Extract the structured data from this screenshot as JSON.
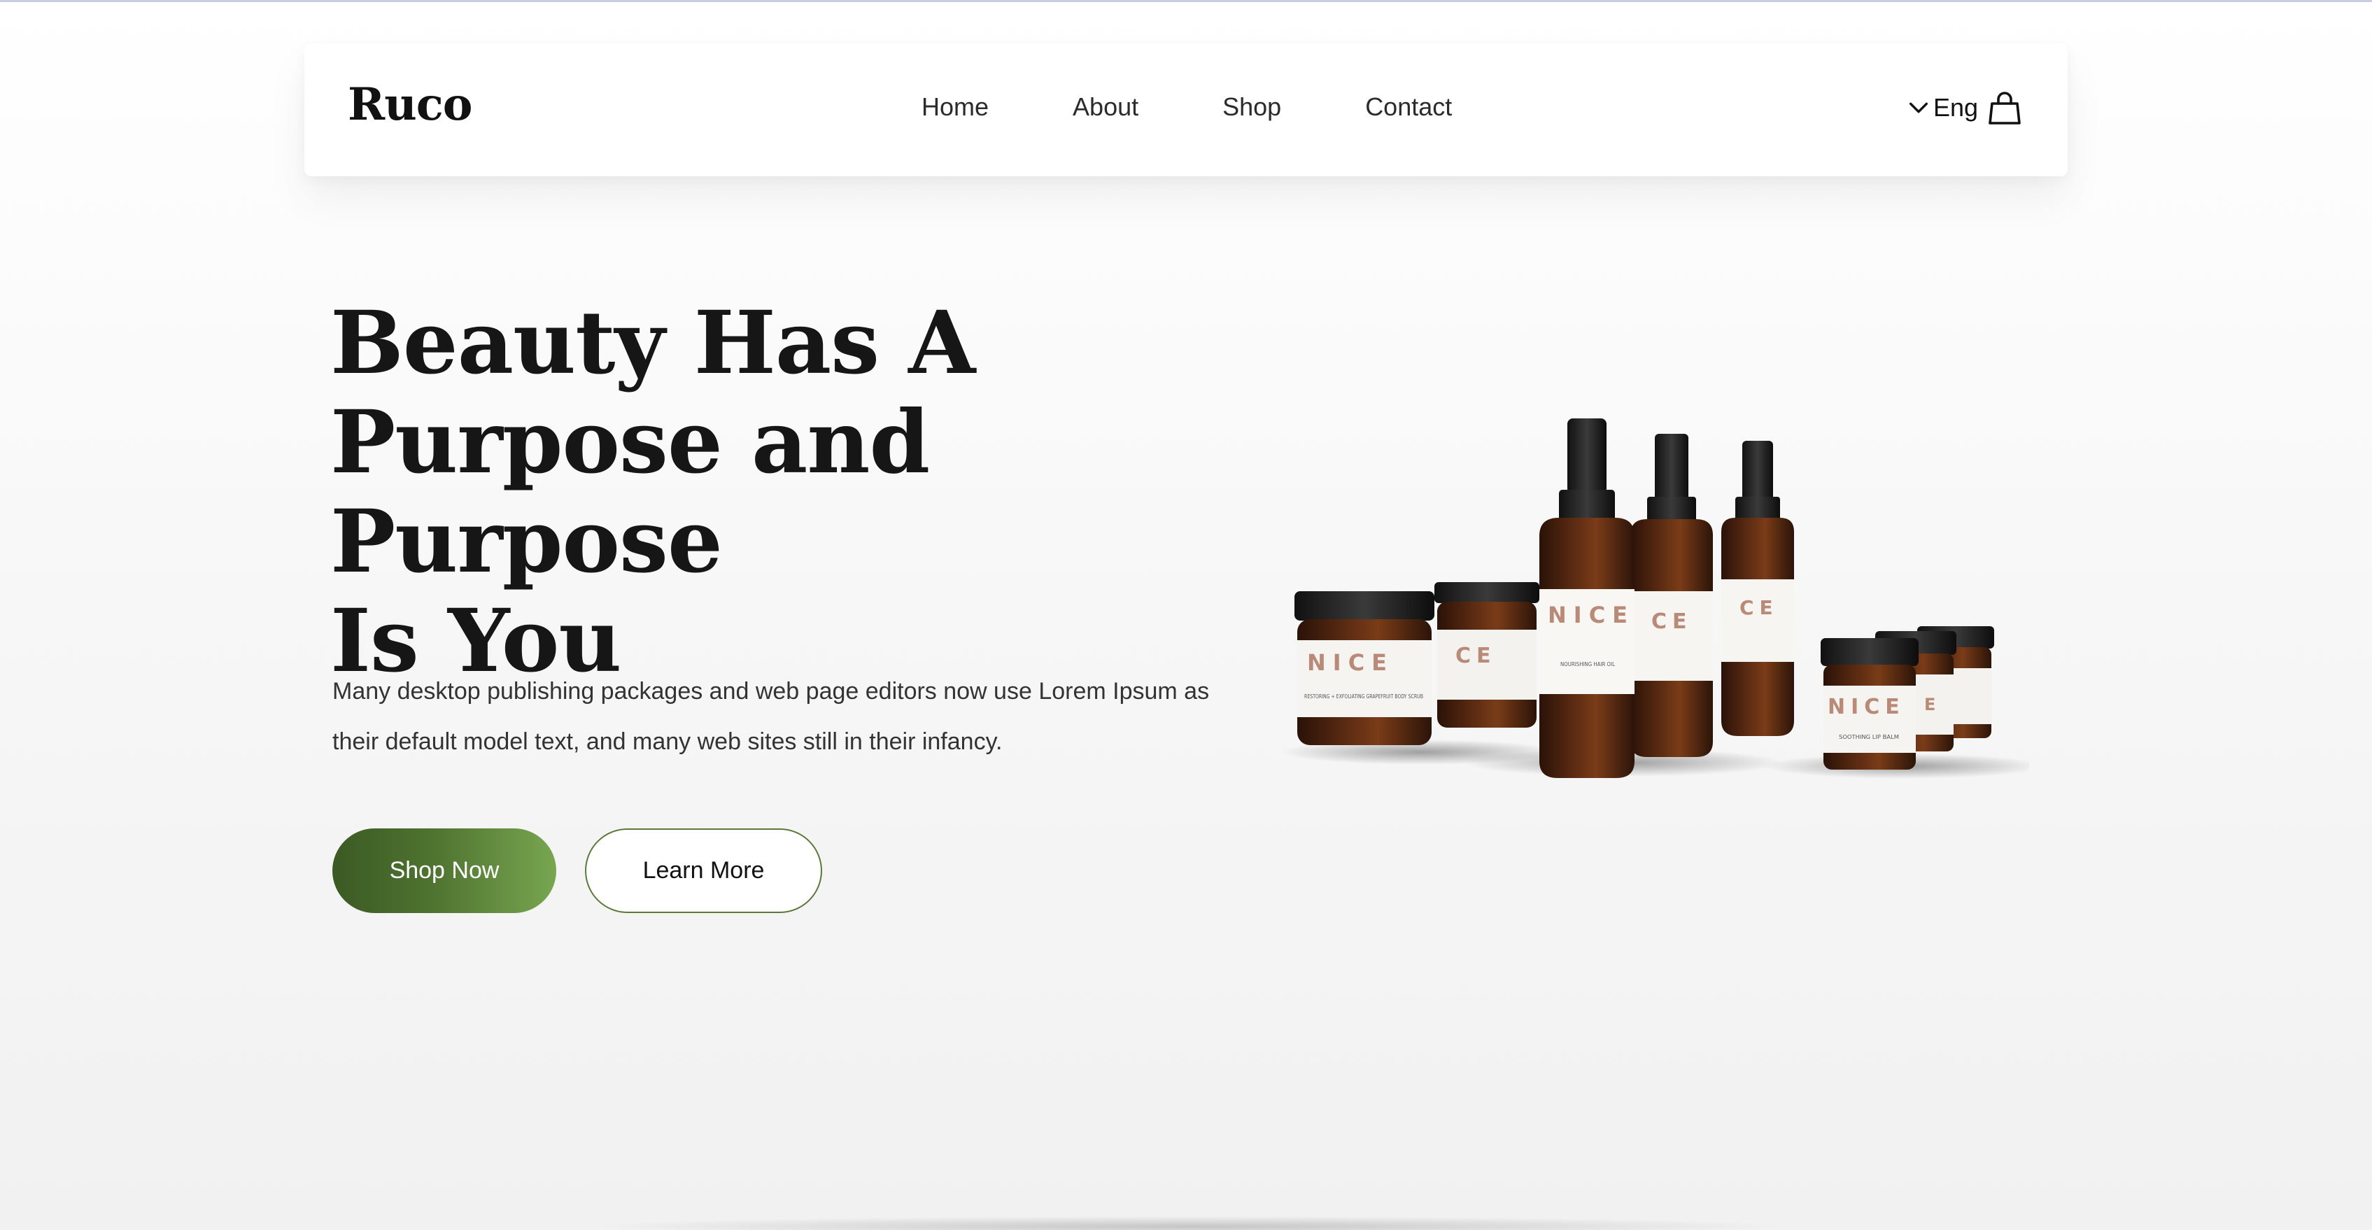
{
  "brand": {
    "logo": "Ruco"
  },
  "nav": {
    "links": [
      "Home",
      "About",
      "Shop",
      "Contact"
    ],
    "language": "Eng"
  },
  "hero": {
    "title_lines": [
      "Beauty Has A",
      "Purpose and Purpose",
      "Is You"
    ],
    "description": "Many desktop publishing packages and web page editors now use Lorem Ipsum as their default model text, and many web sites still in their infancy.",
    "primary_button": "Shop Now",
    "secondary_button": "Learn More"
  },
  "product_labels": {
    "brand_mark": "NICE",
    "scrub": "RESTORING + EXFOLIATING GRAPEFRUIT BODY SCRUB",
    "hair_oil": "NOURISHING HAIR OIL",
    "lip_balm": "SOOTHING LIP BALM"
  },
  "colors": {
    "accent_dark": "#3b5a24",
    "accent_light": "#78a650",
    "outline": "#5b7a3a",
    "text": "#161616"
  },
  "icons": [
    "chevron-down-icon",
    "shopping-bag-icon"
  ]
}
